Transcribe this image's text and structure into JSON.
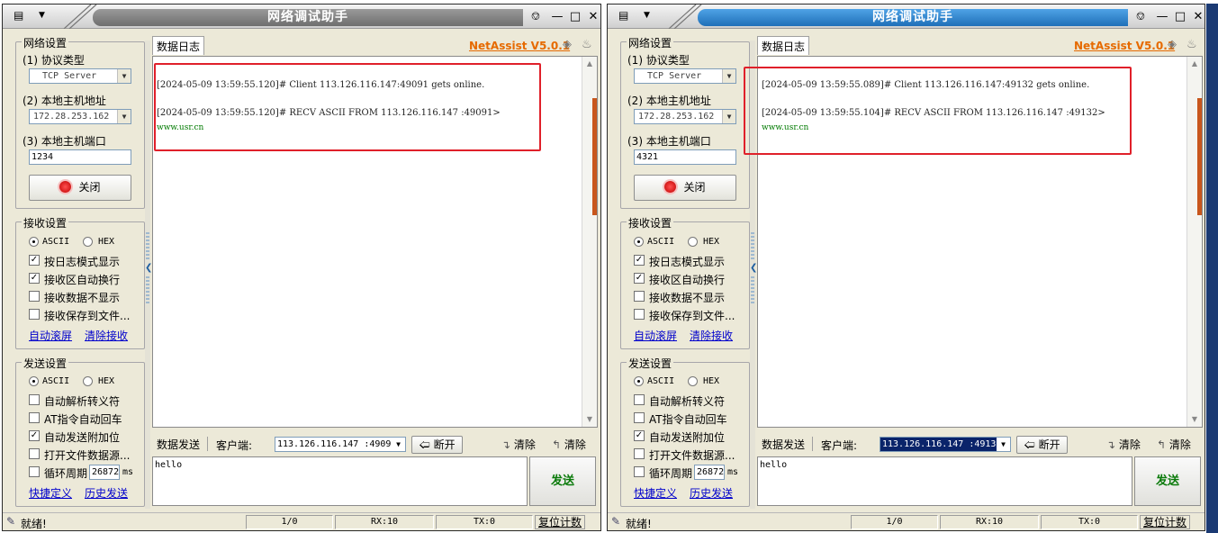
{
  "colors": {
    "accent": "#e66a00",
    "highlight": "#e0202a",
    "log_data": "#007a00",
    "title_active": "#1f6fb8"
  },
  "windows": [
    {
      "title": "网络调试助手",
      "version": "NetAssist V5.0.1",
      "net": {
        "group": "网络设置",
        "proto_label": "(1) 协议类型",
        "proto_value": "TCP Server",
        "host_label": "(2) 本地主机地址",
        "host_value": "172.28.253.162",
        "port_label": "(3) 本地主机端口",
        "port_value": "1234",
        "toggle_label": "关闭"
      },
      "recv_settings": {
        "group": "接收设置",
        "ascii": "ASCII",
        "hex": "HEX",
        "opt1": "按日志模式显示",
        "opt2": "接收区自动换行",
        "opt3": "接收数据不显示",
        "opt4": "接收保存到文件...",
        "link1": "自动滚屏",
        "link2": "清除接收"
      },
      "send_settings": {
        "group": "发送设置",
        "ascii": "ASCII",
        "hex": "HEX",
        "opt1": "自动解析转义符",
        "opt2": "AT指令自动回车",
        "opt3": "自动发送附加位",
        "opt4": "打开文件数据源...",
        "opt5": "循环周期",
        "period": "26872",
        "unit": "ms",
        "link1": "快捷定义",
        "link2": "历史发送"
      },
      "log_tab": "数据日志",
      "log": [
        "[2024-05-09 13:59:55.120]# Client 113.126.116.147:49091 gets online.",
        "[2024-05-09 13:59:55.120]# RECV ASCII FROM 113.126.116.147 :49091>",
        "www.usr.cn"
      ],
      "sendbar": {
        "tab": "数据发送",
        "client_label": "客户端:",
        "client_value": "113.126.116.147 :4909",
        "disconnect": "断开",
        "clear1": "清除",
        "clear2": "清除"
      },
      "send_text": "hello",
      "send_button": "发送",
      "status": {
        "ready": "就绪!",
        "count": "1/0",
        "rx": "RX:10",
        "tx": "TX:0",
        "reset": "复位计数"
      }
    },
    {
      "title": "网络调试助手",
      "version": "NetAssist V5.0.1",
      "net": {
        "group": "网络设置",
        "proto_label": "(1) 协议类型",
        "proto_value": "TCP Server",
        "host_label": "(2) 本地主机地址",
        "host_value": "172.28.253.162",
        "port_label": "(3) 本地主机端口",
        "port_value": "4321",
        "toggle_label": "关闭"
      },
      "recv_settings": {
        "group": "接收设置",
        "ascii": "ASCII",
        "hex": "HEX",
        "opt1": "按日志模式显示",
        "opt2": "接收区自动换行",
        "opt3": "接收数据不显示",
        "opt4": "接收保存到文件...",
        "link1": "自动滚屏",
        "link2": "清除接收"
      },
      "send_settings": {
        "group": "发送设置",
        "ascii": "ASCII",
        "hex": "HEX",
        "opt1": "自动解析转义符",
        "opt2": "AT指令自动回车",
        "opt3": "自动发送附加位",
        "opt4": "打开文件数据源...",
        "opt5": "循环周期",
        "period": "26872",
        "unit": "ms",
        "link1": "快捷定义",
        "link2": "历史发送"
      },
      "log_tab": "数据日志",
      "log": [
        "[2024-05-09 13:59:55.089]# Client 113.126.116.147:49132 gets online.",
        "[2024-05-09 13:59:55.104]# RECV ASCII FROM 113.126.116.147 :49132>",
        "www.usr.cn"
      ],
      "sendbar": {
        "tab": "数据发送",
        "client_label": "客户端:",
        "client_value": "113.126.116.147 :4913",
        "disconnect": "断开",
        "clear1": "清除",
        "clear2": "清除"
      },
      "send_text": "hello",
      "send_button": "发送",
      "status": {
        "ready": "就绪!",
        "count": "1/0",
        "rx": "RX:10",
        "tx": "TX:0",
        "reset": "复位计数"
      }
    }
  ]
}
